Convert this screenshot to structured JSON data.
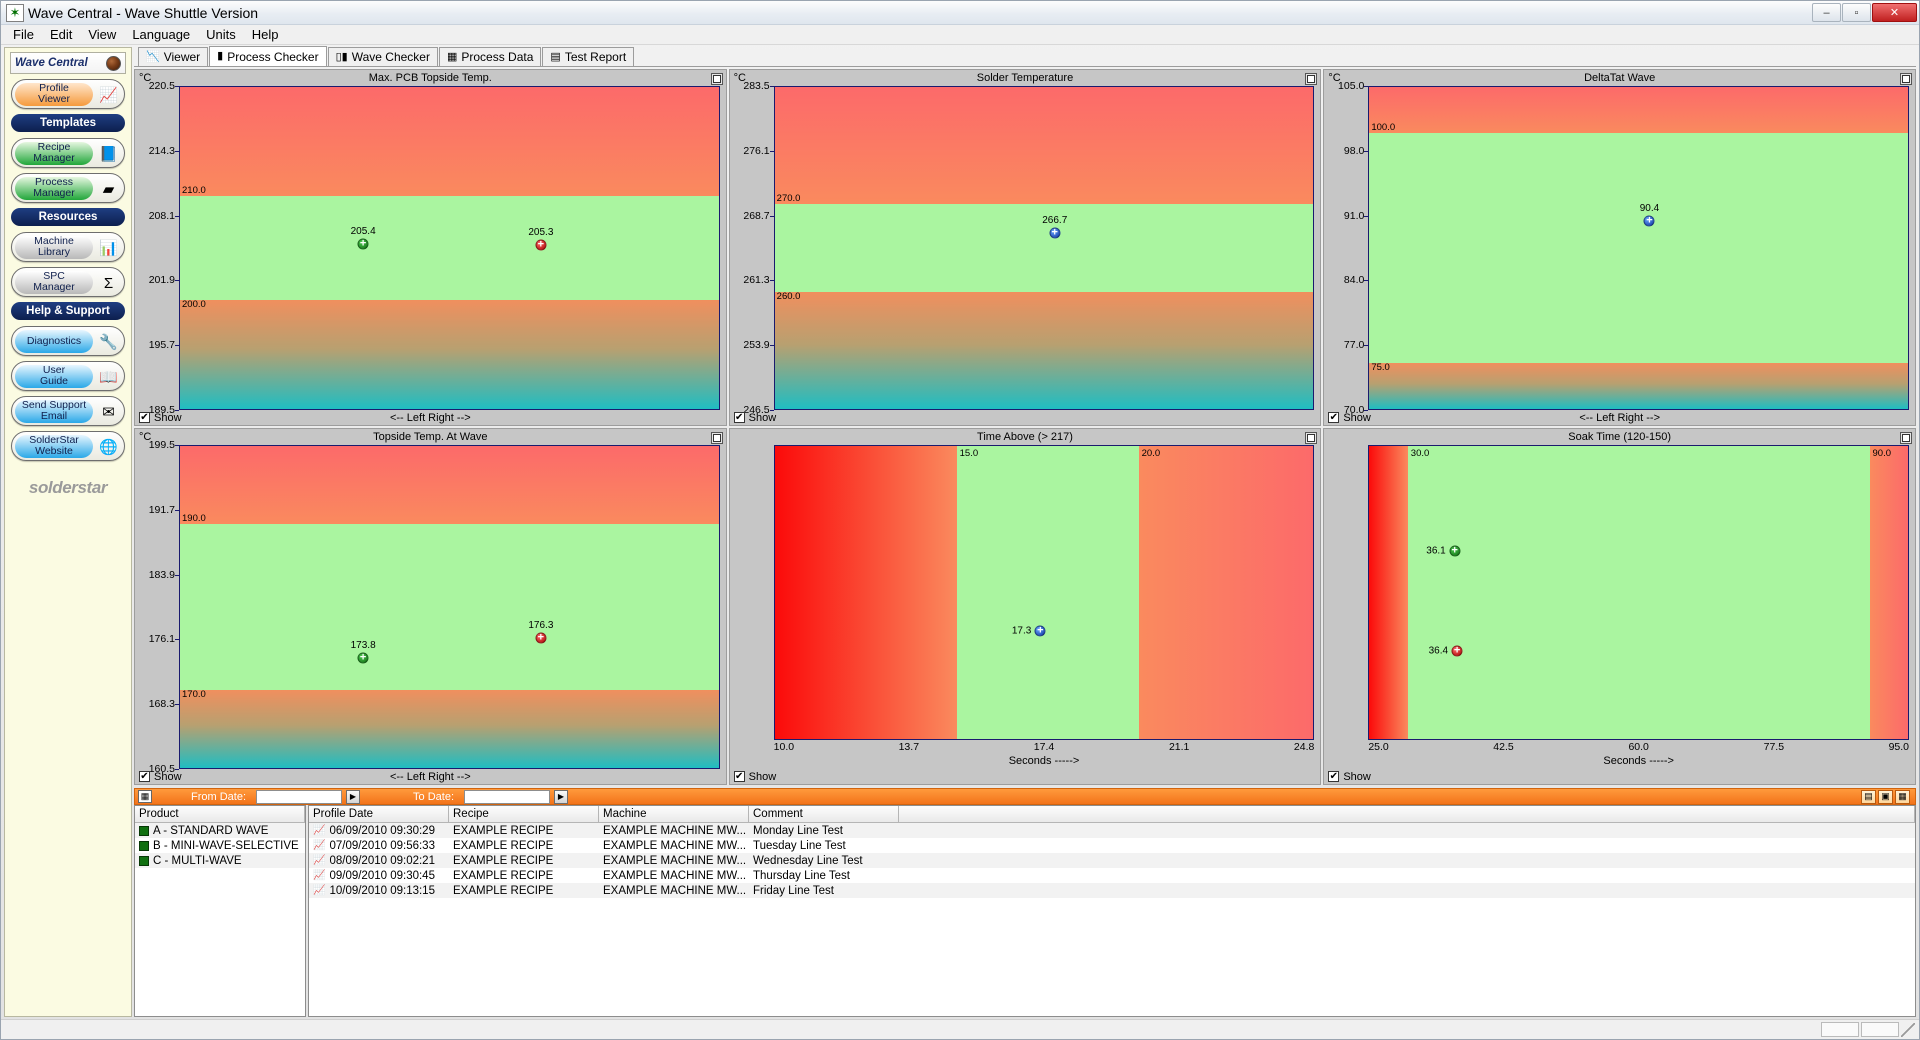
{
  "window": {
    "title": "Wave Central - Wave Shuttle Version",
    "app_icon": "star-icon",
    "minimize": "–",
    "maximize": "▫",
    "close": "✕"
  },
  "menu": [
    "File",
    "Edit",
    "View",
    "Language",
    "Units",
    "Help"
  ],
  "sidebar": {
    "brand": "Wave Central",
    "groups": [
      {
        "type": "button",
        "label": "Profile\nViewer",
        "label_line1": "Profile",
        "label_line2": "Viewer",
        "style": "orange",
        "icon": "chart-device-icon",
        "glyph": "📈"
      },
      {
        "type": "section",
        "label": "Templates"
      },
      {
        "type": "button",
        "label_line1": "Recipe",
        "label_line2": "Manager",
        "style": "green",
        "icon": "recipe-book-icon",
        "glyph": "📘"
      },
      {
        "type": "button",
        "label_line1": "Process",
        "label_line2": "Manager",
        "style": "green",
        "icon": "pcb-board-icon",
        "glyph": "▰"
      },
      {
        "type": "section",
        "label": "Resources"
      },
      {
        "type": "button",
        "label_line1": "Machine",
        "label_line2": "Library",
        "style": "grey",
        "icon": "machine-icon",
        "glyph": "📊"
      },
      {
        "type": "button",
        "label_line1": "SPC",
        "label_line2": "Manager",
        "style": "grey",
        "icon": "sigma-icon",
        "glyph": "Σ"
      },
      {
        "type": "section",
        "label": "Help & Support"
      },
      {
        "type": "button",
        "label_line1": "Diagnostics",
        "label_line2": "",
        "style": "blue",
        "icon": "wrench-icon",
        "glyph": "🔧"
      },
      {
        "type": "button",
        "label_line1": "User",
        "label_line2": "Guide",
        "style": "blue",
        "icon": "help-book-icon",
        "glyph": "📖"
      },
      {
        "type": "button",
        "label_line1": "Send Support",
        "label_line2": "Email",
        "style": "blue",
        "icon": "mail-arrow-icon",
        "glyph": "✉"
      },
      {
        "type": "button",
        "label_line1": "SolderStar",
        "label_line2": "Website",
        "style": "blue",
        "icon": "globe-icon",
        "glyph": "🌐"
      }
    ],
    "logo": "solderstar"
  },
  "tabs": [
    {
      "label": "Viewer",
      "icon": "profile-trace-icon",
      "glyph": "📉",
      "active": false
    },
    {
      "label": "Process Checker",
      "icon": "bar-chart-icon",
      "glyph": "▮",
      "active": true
    },
    {
      "label": "Wave Checker",
      "icon": "wave-bars-icon",
      "glyph": "▯▮",
      "active": false
    },
    {
      "label": "Process Data",
      "icon": "grid-data-icon",
      "glyph": "▦",
      "active": false
    },
    {
      "label": "Test Report",
      "icon": "report-icon",
      "glyph": "▤",
      "active": false
    }
  ],
  "charts": [
    {
      "title": "Max. PCB Topside Temp.",
      "unit": "°C",
      "show_label": "Show",
      "show_checked": true,
      "axis_label": "<-- Left Right -->",
      "maximize_icon": "maximize-icon"
    },
    {
      "title": "Solder Temperature",
      "unit": "°C",
      "show_label": "Show",
      "show_checked": true,
      "axis_label": "",
      "maximize_icon": "maximize-icon"
    },
    {
      "title": "DeltaTat Wave",
      "unit": "°C",
      "show_label": "Show",
      "show_checked": true,
      "axis_label": "<-- Left Right -->",
      "maximize_icon": "maximize-icon"
    },
    {
      "title": "Topside Temp. At Wave",
      "unit": "°C",
      "show_label": "Show",
      "show_checked": true,
      "axis_label": "<-- Left Right -->",
      "maximize_icon": "maximize-icon"
    },
    {
      "title": "Time Above (> 217)",
      "unit": "",
      "show_label": "Show",
      "show_checked": true,
      "axis_label": "Seconds ----->",
      "maximize_icon": "maximize-icon"
    },
    {
      "title": "Soak Time (120-150)",
      "unit": "",
      "show_label": "Show",
      "show_checked": true,
      "axis_label": "Seconds ----->",
      "maximize_icon": "maximize-icon"
    }
  ],
  "chart_data": [
    {
      "type": "scatter",
      "title": "Max. PCB Topside Temp.",
      "ylabel": "°C",
      "xlabel": "<-- Left Right -->",
      "orientation": "vertical",
      "ylim": [
        189.5,
        220.5
      ],
      "yticks": [
        "220.5",
        "214.3",
        "208.1",
        "201.9",
        "195.7",
        "189.5"
      ],
      "ytick_values": [
        220.5,
        214.3,
        208.1,
        201.9,
        195.7,
        189.5
      ],
      "limits": {
        "upper": 210.0,
        "lower": 200.0,
        "upper_label": "210.0",
        "lower_label": "200.0"
      },
      "points": [
        {
          "label": "205.4",
          "value": 205.4,
          "x_frac": 0.34,
          "color": "green"
        },
        {
          "label": "205.3",
          "value": 205.3,
          "x_frac": 0.67,
          "color": "red"
        }
      ]
    },
    {
      "type": "scatter",
      "title": "Solder Temperature",
      "ylabel": "°C",
      "xlabel": "",
      "orientation": "vertical",
      "ylim": [
        246.5,
        283.5
      ],
      "yticks": [
        "283.5",
        "276.1",
        "268.7",
        "261.3",
        "253.9",
        "246.5"
      ],
      "ytick_values": [
        283.5,
        276.1,
        268.7,
        261.3,
        253.9,
        246.5
      ],
      "limits": {
        "upper": 270.0,
        "lower": 260.0,
        "upper_label": "270.0",
        "lower_label": "260.0"
      },
      "points": [
        {
          "label": "266.7",
          "value": 266.7,
          "x_frac": 0.52,
          "color": "blue"
        }
      ]
    },
    {
      "type": "scatter",
      "title": "DeltaTat Wave",
      "ylabel": "°C",
      "xlabel": "<-- Left Right -->",
      "orientation": "vertical",
      "ylim": [
        70.0,
        105.0
      ],
      "yticks": [
        "105.0",
        "98.0",
        "91.0",
        "84.0",
        "77.0",
        "70.0"
      ],
      "ytick_values": [
        105.0,
        98.0,
        91.0,
        84.0,
        77.0,
        70.0
      ],
      "limits": {
        "upper": 100.0,
        "lower": 75.0,
        "upper_label": "100.0",
        "lower_label": "75.0"
      },
      "points": [
        {
          "label": "90.4",
          "value": 90.4,
          "x_frac": 0.52,
          "color": "blue"
        }
      ]
    },
    {
      "type": "scatter",
      "title": "Topside Temp. At Wave",
      "ylabel": "°C",
      "xlabel": "<-- Left Right -->",
      "orientation": "vertical",
      "ylim": [
        160.5,
        199.5
      ],
      "yticks": [
        "199.5",
        "191.7",
        "183.9",
        "176.1",
        "168.3",
        "160.5"
      ],
      "ytick_values": [
        199.5,
        191.7,
        183.9,
        176.1,
        168.3,
        160.5
      ],
      "limits": {
        "upper": 190.0,
        "lower": 170.0,
        "upper_label": "190.0",
        "lower_label": "170.0"
      },
      "points": [
        {
          "label": "173.8",
          "value": 173.8,
          "x_frac": 0.34,
          "color": "green"
        },
        {
          "label": "176.3",
          "value": 176.3,
          "x_frac": 0.67,
          "color": "red"
        }
      ]
    },
    {
      "type": "scatter",
      "title": "Time Above (> 217)",
      "ylabel": "",
      "xlabel": "Seconds ----->",
      "orientation": "horizontal",
      "xlim": [
        10.0,
        24.8
      ],
      "xticks": [
        "10.0",
        "13.7",
        "17.4",
        "21.1",
        "24.8"
      ],
      "xtick_values": [
        10.0,
        13.7,
        17.4,
        21.1,
        24.8
      ],
      "limits": {
        "lower": 15.0,
        "upper": 20.0,
        "lower_label": "15.0",
        "upper_label": "20.0"
      },
      "points": [
        {
          "label": "17.3",
          "value": 17.3,
          "y_frac": 0.63,
          "color": "blue"
        }
      ]
    },
    {
      "type": "scatter",
      "title": "Soak Time (120-150)",
      "ylabel": "",
      "xlabel": "Seconds ----->",
      "orientation": "horizontal",
      "xlim": [
        25.0,
        95.0
      ],
      "xticks": [
        "25.0",
        "42.5",
        "60.0",
        "77.5",
        "95.0"
      ],
      "xtick_values": [
        25.0,
        42.5,
        60.0,
        77.5,
        95.0
      ],
      "limits": {
        "lower": 30.0,
        "upper": 90.0,
        "lower_label": "30.0",
        "upper_label": "90.0"
      },
      "points": [
        {
          "label": "36.1",
          "value": 36.1,
          "y_frac": 0.36,
          "color": "green"
        },
        {
          "label": "36.4",
          "value": 36.4,
          "y_frac": 0.7,
          "color": "red"
        }
      ]
    }
  ],
  "datebar": {
    "calendar_icon": "calendar-icon",
    "from_label": "From Date:",
    "to_label": "To Date:",
    "from_value": "",
    "to_value": "",
    "dropdown_glyph": "▶",
    "tools": [
      "export-icon",
      "print-icon",
      "grid-icon"
    ]
  },
  "product_grid": {
    "header": "Product",
    "rows": [
      {
        "icon": "product-icon",
        "label": "A - STANDARD WAVE"
      },
      {
        "icon": "product-icon",
        "label": "B - MINI-WAVE-SELECTIVE"
      },
      {
        "icon": "product-icon",
        "label": "C - MULTI-WAVE"
      }
    ]
  },
  "profile_grid": {
    "headers": [
      "Profile Date",
      "Recipe",
      "Machine",
      "Comment",
      ""
    ],
    "rows": [
      {
        "icon": "profile-icon",
        "date": "06/09/2010 09:30:29",
        "recipe": "EXAMPLE RECIPE",
        "machine": "EXAMPLE MACHINE MW...",
        "comment": "Monday Line Test"
      },
      {
        "icon": "profile-icon",
        "date": "07/09/2010 09:56:33",
        "recipe": "EXAMPLE RECIPE",
        "machine": "EXAMPLE MACHINE MW...",
        "comment": "Tuesday Line Test"
      },
      {
        "icon": "profile-icon",
        "date": "08/09/2010 09:02:21",
        "recipe": "EXAMPLE RECIPE",
        "machine": "EXAMPLE MACHINE MW...",
        "comment": "Wednesday Line Test"
      },
      {
        "icon": "profile-icon",
        "date": "09/09/2010 09:30:45",
        "recipe": "EXAMPLE RECIPE",
        "machine": "EXAMPLE MACHINE MW...",
        "comment": "Thursday Line Test"
      },
      {
        "icon": "profile-icon",
        "date": "10/09/2010 09:13:15",
        "recipe": "EXAMPLE RECIPE",
        "machine": "EXAMPLE MACHINE MW...",
        "comment": "Friday Line Test"
      }
    ]
  },
  "colors": {
    "accent_orange": "#f3731a",
    "in_spec_green": "#aaf5a0",
    "warn_orange": "#fa8a5e",
    "fail_red": "#fc6a6a",
    "cool_teal": "#1fbdc2",
    "header_navy": "#14306d"
  }
}
